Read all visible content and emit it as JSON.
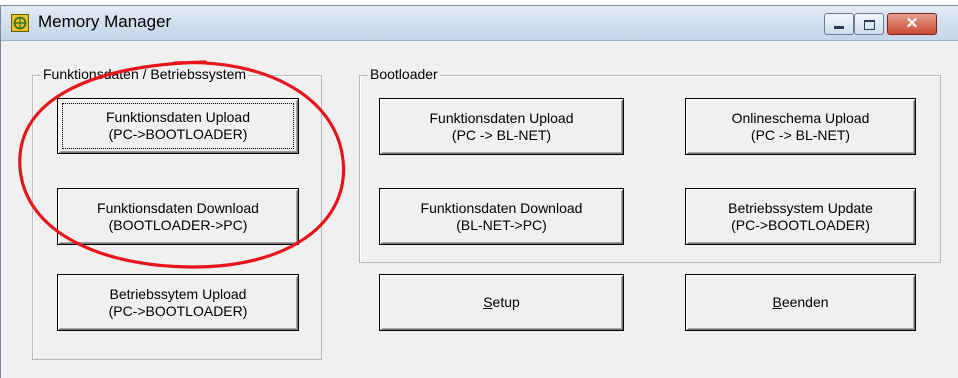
{
  "window": {
    "title": "Memory Manager",
    "icon": "app-icon",
    "buttons": {
      "minimize": "minimize-icon",
      "maximize": "maximize-icon",
      "close": "close-icon"
    },
    "close_glyph": "✕"
  },
  "groups": {
    "left": {
      "label": "Funktionsdaten / Betriebssystem",
      "buttons": [
        {
          "line1": "Funktionsdaten Upload",
          "line2": "(PC->BOOTLOADER)"
        },
        {
          "line1": "Funktionsdaten Download",
          "line2": "(BOOTLOADER->PC)"
        },
        {
          "line1": "Betriebssytem Upload",
          "line2": "(PC->BOOTLOADER)"
        }
      ]
    },
    "right": {
      "label": "Bootloader",
      "buttons": [
        {
          "line1": "Funktionsdaten Upload",
          "line2": "(PC -> BL-NET)"
        },
        {
          "line1": "Onlineschema Upload",
          "line2": "(PC -> BL-NET)"
        },
        {
          "line1": "Funktionsdaten Download",
          "line2": "(BL-NET->PC)"
        },
        {
          "line1": "Betriebssystem Update",
          "line2": "(PC->BOOTLOADER)"
        }
      ]
    }
  },
  "actions": {
    "setup": {
      "accel": "S",
      "rest": "etup"
    },
    "exit": {
      "accel": "B",
      "rest": "eenden"
    }
  },
  "annotation": {
    "color": "#e8141c",
    "shape": "ellipse"
  }
}
